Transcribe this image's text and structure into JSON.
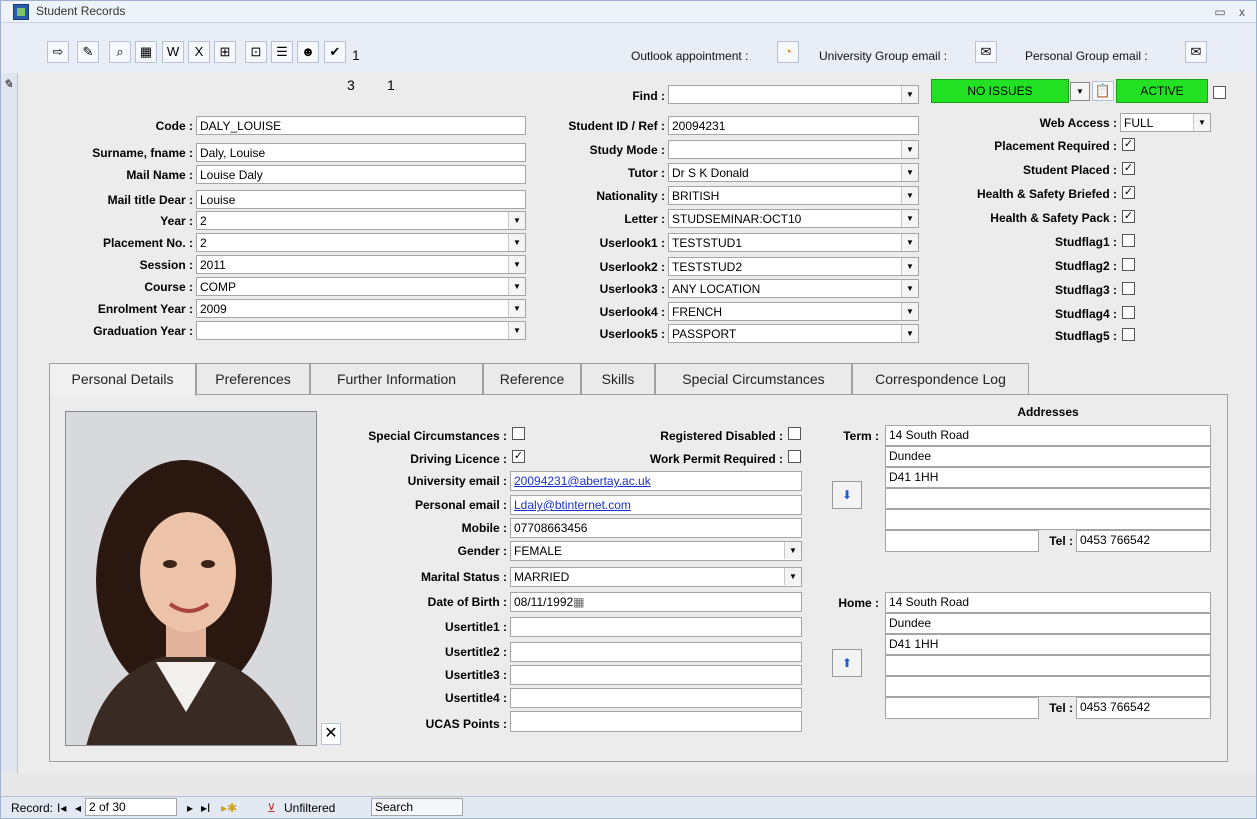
{
  "window": {
    "title": "Student Records",
    "minimize": "▭",
    "close": "x"
  },
  "toolbar": {
    "record_count": "1",
    "outlook_label": "Outlook appointment :",
    "uni_email_label": "University Group email :",
    "personal_email_label": "Personal Group email :"
  },
  "header": {
    "count_a": "3",
    "count_b": "1"
  },
  "find": {
    "label": "Find :",
    "value": ""
  },
  "status": {
    "issues": "NO ISSUES",
    "active": "ACTIVE"
  },
  "left_fields": [
    {
      "label": "Code :",
      "value": "DALY_LOUISE",
      "combo": false
    },
    {
      "label": "Surname, fname :",
      "value": "Daly, Louise",
      "combo": false
    },
    {
      "label": "Mail Name :",
      "value": "Louise Daly",
      "combo": false
    },
    {
      "label": "Mail title Dear :",
      "value": "Louise",
      "combo": false
    },
    {
      "label": "Year :",
      "value": "2",
      "combo": true
    },
    {
      "label": "Placement No. :",
      "value": "2",
      "combo": true
    },
    {
      "label": "Session :",
      "value": "2011",
      "combo": true
    },
    {
      "label": "Course :",
      "value": "COMP",
      "combo": true
    },
    {
      "label": "Enrolment Year :",
      "value": "2009",
      "combo": true
    },
    {
      "label": "Graduation Year :",
      "value": "",
      "combo": true
    }
  ],
  "mid_fields": [
    {
      "label": "Student ID / Ref :",
      "value": "20094231",
      "combo": false
    },
    {
      "label": "Study Mode :",
      "value": "",
      "combo": true
    },
    {
      "label": "Tutor :",
      "value": "Dr S K Donald",
      "combo": true
    },
    {
      "label": "Nationality :",
      "value": "BRITISH",
      "combo": true
    },
    {
      "label": "Letter :",
      "value": "STUDSEMINAR:OCT10",
      "combo": true
    },
    {
      "label": "Userlook1 :",
      "value": "TESTSTUD1",
      "combo": true
    },
    {
      "label": "Userlook2 :",
      "value": "TESTSTUD2",
      "combo": true
    },
    {
      "label": "Userlook3 :",
      "value": "ANY LOCATION",
      "combo": true
    },
    {
      "label": "Userlook4 :",
      "value": "FRENCH",
      "combo": true
    },
    {
      "label": "Userlook5 :",
      "value": "PASSPORT",
      "combo": true
    }
  ],
  "web_access": {
    "label": "Web Access :",
    "value": "FULL"
  },
  "right_flags": [
    {
      "label": "Placement Required :",
      "checked": true
    },
    {
      "label": "Student Placed :",
      "checked": true
    },
    {
      "label": "Health & Safety  Briefed :",
      "checked": true
    },
    {
      "label": "Health & Safety Pack :",
      "checked": true
    },
    {
      "label": "Studflag1 :",
      "checked": false
    },
    {
      "label": "Studflag2 :",
      "checked": false
    },
    {
      "label": "Studflag3 :",
      "checked": false
    },
    {
      "label": "Studflag4 :",
      "checked": false
    },
    {
      "label": "Studflag5 :",
      "checked": false
    }
  ],
  "tabs": [
    "Personal Details",
    "Preferences",
    "Further Information",
    "Reference",
    "Skills",
    "Special Circumstances",
    "Correspondence Log"
  ],
  "personal": {
    "special_circ": "Special Circumstances :",
    "registered_disabled": "Registered Disabled :",
    "driving_licence": "Driving Licence :",
    "work_permit": "Work Permit Required :",
    "uni_email_label": "University email :",
    "uni_email": "20094231@abertay.ac.uk",
    "personal_email_label": "Personal email :",
    "personal_email": "Ldaly@btinternet.com",
    "mobile_label": "Mobile :",
    "mobile": "07708663456",
    "gender_label": "Gender :",
    "gender": "FEMALE",
    "marital_label": "Marital Status :",
    "marital": "MARRIED",
    "dob_label": "Date of Birth :",
    "dob": "08/11/1992",
    "usertitles": [
      "Usertitle1 :",
      "Usertitle2 :",
      "Usertitle3 :",
      "Usertitle4 :"
    ],
    "ucas_label": "UCAS Points :"
  },
  "addresses": {
    "heading": "Addresses",
    "term_label": "Term :",
    "term": [
      "14 South Road",
      "Dundee",
      "D41 1HH",
      "",
      ""
    ],
    "term_tel": "0453 766542",
    "home_label": "Home :",
    "home": [
      "14 South Road",
      "Dundee",
      "D41 1HH",
      "",
      ""
    ],
    "home_tel": "0453 766542",
    "tel_label": "Tel :"
  },
  "navbar": {
    "record_label": "Record:",
    "position": "2 of 30",
    "filter": "Unfiltered",
    "search": "Search"
  }
}
